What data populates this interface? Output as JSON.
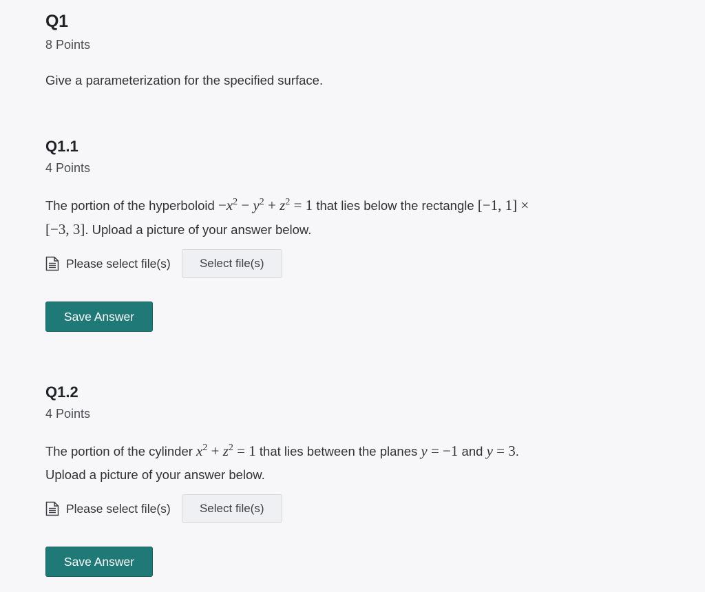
{
  "q1": {
    "title": "Q1",
    "points": "8 Points",
    "prompt": "Give a parameterization for the specified surface."
  },
  "q1_1": {
    "title": "Q1.1",
    "points": "4 Points",
    "prompt_part1": "The portion of the hyperboloid",
    "prompt_part2": "that lies below the rectangle",
    "prompt_part3": ". Upload a picture of your answer below.",
    "file_label": "Please select file(s)",
    "select_button": "Select file(s)",
    "save_button": "Save Answer"
  },
  "q1_2": {
    "title": "Q1.2",
    "points": "4 Points",
    "prompt_part1": "The portion of the cylinder",
    "prompt_part2": "that lies between the planes",
    "prompt_part3": "and",
    "prompt_part4": ".",
    "prompt_line2": "Upload a picture of your answer below.",
    "file_label": "Please select file(s)",
    "select_button": "Select file(s)",
    "save_button": "Save Answer"
  },
  "icons": {
    "file": "document-icon"
  },
  "colors": {
    "save_button_bg": "#1f7a77",
    "page_bg": "#f7f7f9"
  }
}
